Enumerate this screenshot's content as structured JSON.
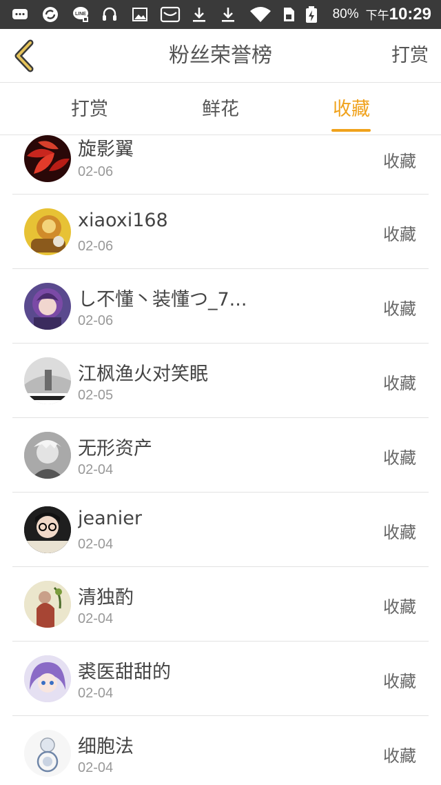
{
  "status_bar": {
    "battery_percent": "80%",
    "time_prefix": "下午",
    "time": "10:29",
    "icons": [
      "message-icon",
      "sync-icon",
      "line-icon",
      "headset-icon",
      "image-icon",
      "inbox-icon",
      "download-icon",
      "download-icon",
      "wifi-icon",
      "sim-icon",
      "battery-charging-icon"
    ]
  },
  "header": {
    "title": "粉丝荣誉榜",
    "right_action": "打赏",
    "back_icon": "chevron-left-icon"
  },
  "tabs": [
    {
      "label": "打赏",
      "active": false
    },
    {
      "label": "鲜花",
      "active": false
    },
    {
      "label": "收藏",
      "active": true
    }
  ],
  "accent_color": "#f0a21c",
  "fans": [
    {
      "name": "旋影翼",
      "date": "02-06",
      "action": "收藏"
    },
    {
      "name": "xiaoxi168",
      "date": "02-06",
      "action": "收藏"
    },
    {
      "name": "し不懂丶装懂つ_7...",
      "date": "02-06",
      "action": "收藏"
    },
    {
      "name": "江枫渔火对笑眠",
      "date": "02-05",
      "action": "收藏"
    },
    {
      "name": "无形资产",
      "date": "02-04",
      "action": "收藏"
    },
    {
      "name": "jeanier",
      "date": "02-04",
      "action": "收藏"
    },
    {
      "name": "清独酌",
      "date": "02-04",
      "action": "收藏"
    },
    {
      "name": "裘医甜甜的",
      "date": "02-04",
      "action": "收藏"
    },
    {
      "name": "细胞法",
      "date": "02-04",
      "action": "收藏"
    }
  ]
}
